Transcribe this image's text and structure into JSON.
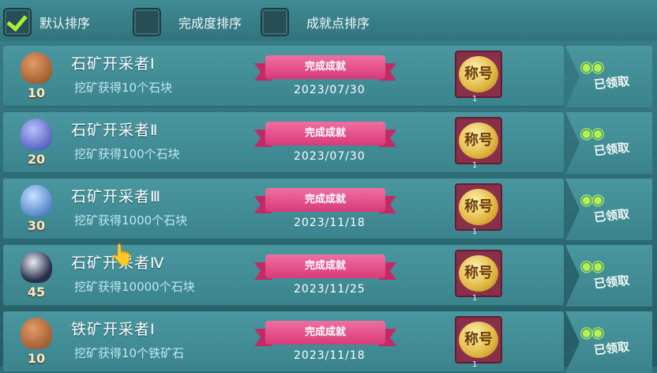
{
  "sort_options": [
    {
      "label": "默认排序",
      "checked": true
    },
    {
      "label": "完成度排序",
      "checked": false
    },
    {
      "label": "成就点排序",
      "checked": false
    }
  ],
  "achievements": [
    {
      "title": "石矿开采者Ⅰ",
      "desc": "挖矿获得10个石块",
      "points": "10",
      "status": "完成成就",
      "date": "2023/07/30",
      "reward": "称号",
      "reward_count": "1",
      "claim": "已领取",
      "medal_color": "#b36a3a"
    },
    {
      "title": "石矿开采者Ⅱ",
      "desc": "挖矿获得100个石块",
      "points": "20",
      "status": "完成成就",
      "date": "2023/07/30",
      "reward": "称号",
      "reward_count": "1",
      "claim": "已领取",
      "medal_color": "#6f7fd8"
    },
    {
      "title": "石矿开采者Ⅲ",
      "desc": "挖矿获得1000个石块",
      "points": "30",
      "status": "完成成就",
      "date": "2023/11/18",
      "reward": "称号",
      "reward_count": "1",
      "claim": "已领取",
      "medal_color": "#5a9ee8"
    },
    {
      "title": "石矿开采者Ⅳ",
      "desc": "挖矿获得10000个石块",
      "points": "45",
      "status": "完成成就",
      "date": "2023/11/25",
      "reward": "称号",
      "reward_count": "1",
      "claim": "已领取",
      "medal_color": "#2a2f4a"
    },
    {
      "title": "铁矿开采者Ⅰ",
      "desc": "挖矿获得10个铁矿石",
      "points": "10",
      "status": "完成成就",
      "date": "2023/11/18",
      "reward": "称号",
      "reward_count": "1",
      "claim": "已领取",
      "medal_color": "#b36a3a"
    }
  ]
}
